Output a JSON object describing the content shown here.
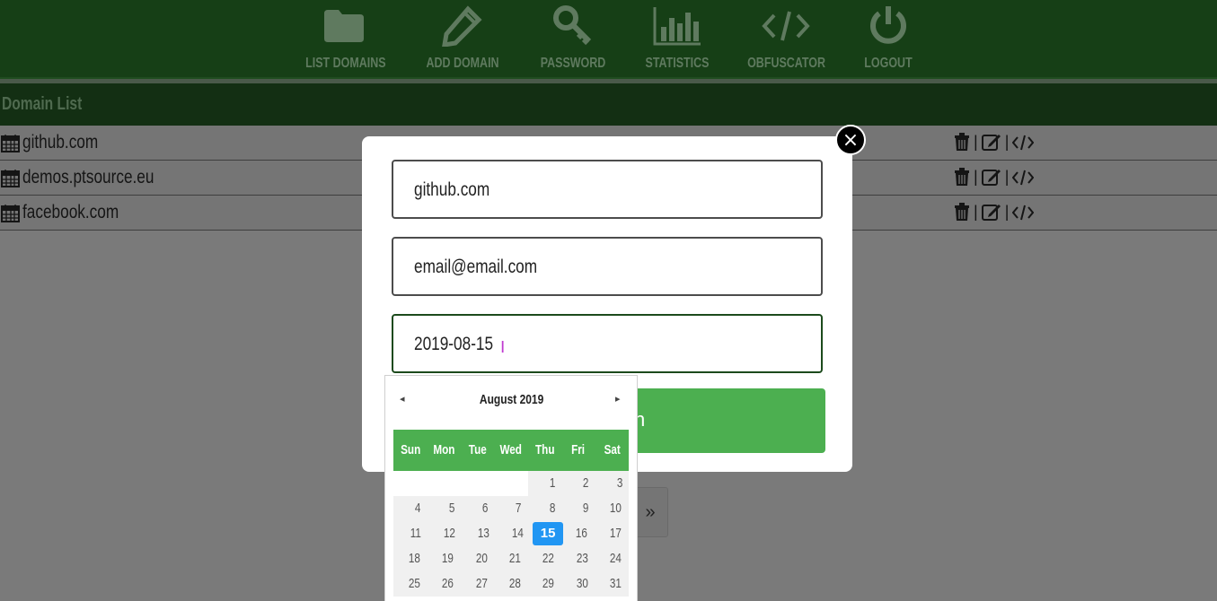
{
  "nav": {
    "items": [
      {
        "label": "LIST DOMAINS",
        "icon": "folder-icon"
      },
      {
        "label": "ADD DOMAIN",
        "icon": "pencil-icon"
      },
      {
        "label": "PASSWORD",
        "icon": "key-icon"
      },
      {
        "label": "STATISTICS",
        "icon": "bar-chart-icon"
      },
      {
        "label": "OBFUSCATOR",
        "icon": "code-icon"
      },
      {
        "label": "LOGOUT",
        "icon": "power-icon"
      }
    ]
  },
  "list": {
    "title": "Domain List",
    "rows": [
      {
        "domain": "github.com"
      },
      {
        "domain": "demos.ptsource.eu"
      },
      {
        "domain": "facebook.com"
      }
    ],
    "separator": "|"
  },
  "pager": {
    "next_label": "»"
  },
  "modal": {
    "close_label": "×",
    "domain_value": "github.com",
    "email_value": "email@email.com",
    "date_value": "2019-08-15",
    "submit_label": "n"
  },
  "datepicker": {
    "prev_label": "◂",
    "next_label": "▸",
    "month_label": "August  2019",
    "weekdays": [
      "Sun",
      "Mon",
      "Tue",
      "Wed",
      "Thu",
      "Fri",
      "Sat"
    ],
    "weeks": [
      [
        "",
        "",
        "",
        "",
        "1",
        "2",
        "3"
      ],
      [
        "4",
        "5",
        "6",
        "7",
        "8",
        "9",
        "10"
      ],
      [
        "11",
        "12",
        "13",
        "14",
        "15",
        "16",
        "17"
      ],
      [
        "18",
        "19",
        "20",
        "21",
        "22",
        "23",
        "24"
      ],
      [
        "25",
        "26",
        "27",
        "28",
        "29",
        "30",
        "31"
      ]
    ],
    "selected_day": "15"
  }
}
